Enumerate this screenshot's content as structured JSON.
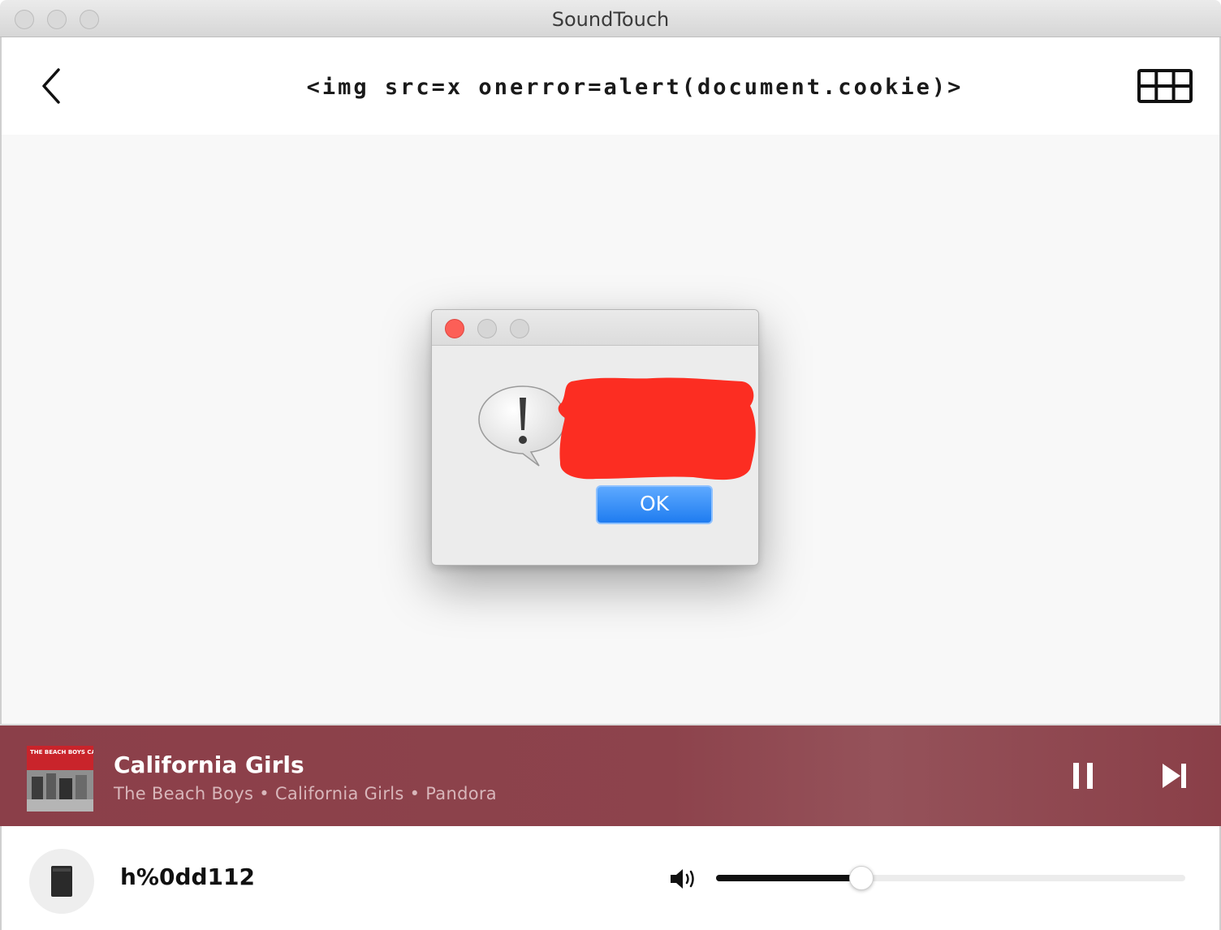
{
  "window": {
    "title": "SoundTouch"
  },
  "header": {
    "title": "<img src=x onerror=alert(document.cookie)>"
  },
  "dialog": {
    "ok_label": "OK",
    "message_redacted": true
  },
  "now_playing": {
    "album_art_text": "THE BEACH BOYS CALIFORNIA GIRLS",
    "title": "California Girls",
    "subtitle": "The Beach Boys • California Girls • Pandora",
    "state": "playing",
    "background_color": "#8b3f49"
  },
  "device": {
    "name": "h%0dd112",
    "icon": "speaker-icon"
  },
  "volume": {
    "level_fraction": 0.31,
    "icon": "volume-icon"
  },
  "icons": {
    "back": "chevron-left-icon",
    "grid": "grid-icon",
    "alert": "alert-icon",
    "pause": "pause-icon",
    "next": "skip-next-icon"
  },
  "colors": {
    "ok_button": "#1f7cf0",
    "close_button": "#fc5f57",
    "redaction": "#fc2d22"
  }
}
